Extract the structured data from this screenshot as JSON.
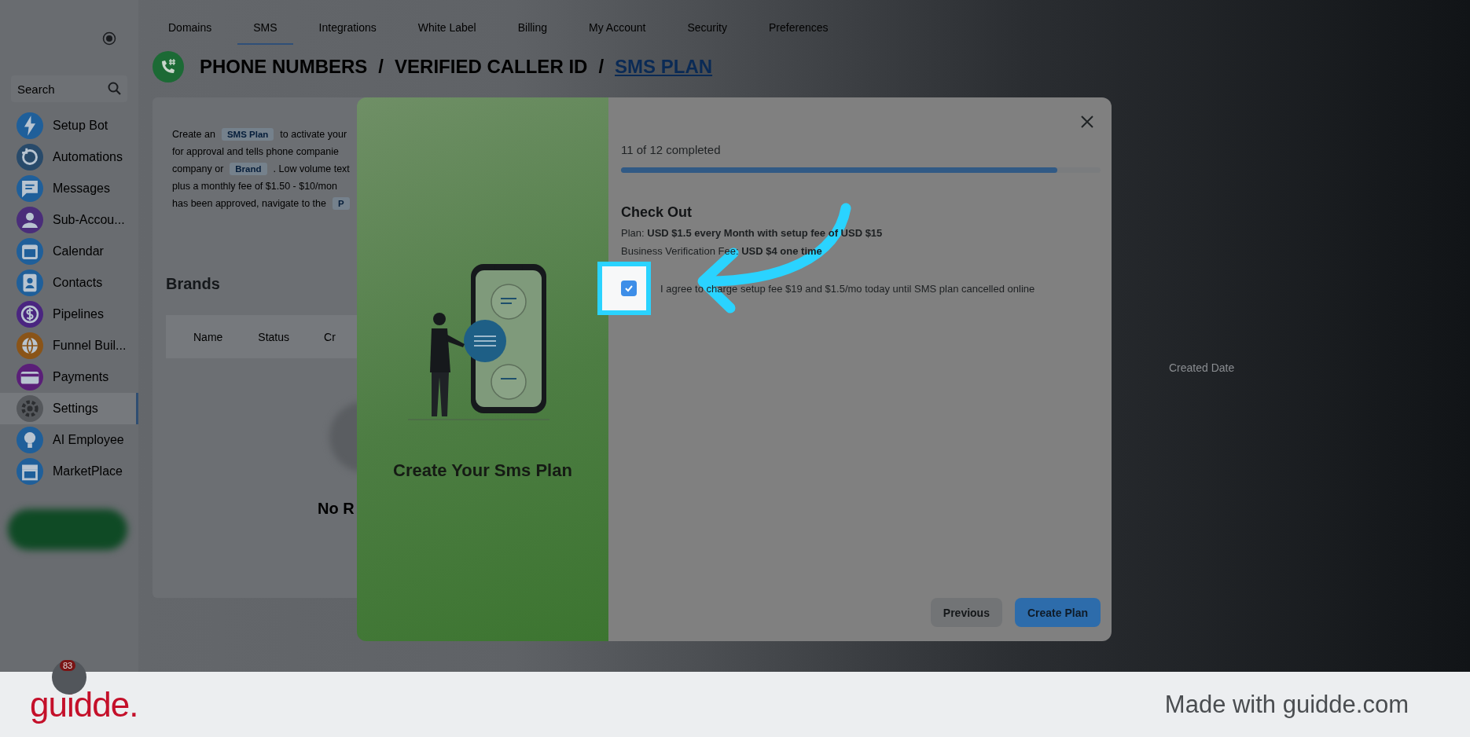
{
  "sidebar": {
    "search": {
      "placeholder": "Search"
    },
    "items": [
      {
        "label": "Setup Bot",
        "color": "#1f5f9a",
        "selected": false
      },
      {
        "label": "Automations",
        "color": "#284a6a",
        "selected": false
      },
      {
        "label": "Messages",
        "color": "#1f5f9a",
        "selected": false
      },
      {
        "label": "Sub-Accou...",
        "color": "#4a2d7a",
        "selected": false
      },
      {
        "label": "Calendar",
        "color": "#1f5f9a",
        "selected": false
      },
      {
        "label": "Contacts",
        "color": "#1f5f9a",
        "selected": false
      },
      {
        "label": "Pipelines",
        "color": "#4a2580",
        "selected": false
      },
      {
        "label": "Funnel Buil...",
        "color": "#8a5418",
        "selected": false
      },
      {
        "label": "Payments",
        "color": "#5a1f78",
        "selected": false
      },
      {
        "label": "Settings",
        "color": "#55585c",
        "selected": true
      },
      {
        "label": "AI Employee",
        "color": "#1f5f9a",
        "selected": false
      },
      {
        "label": "MarketPlace",
        "color": "#1f5f9a",
        "selected": false
      }
    ],
    "notification_badge": "83"
  },
  "top_tabs": [
    {
      "label": "Domains",
      "selected": false
    },
    {
      "label": "SMS",
      "selected": true
    },
    {
      "label": "Integrations",
      "selected": false
    },
    {
      "label": "White Label",
      "selected": false
    },
    {
      "label": "Billing",
      "selected": false
    },
    {
      "label": "My Account",
      "selected": false
    },
    {
      "label": "Security",
      "selected": false
    },
    {
      "label": "Preferences",
      "selected": false
    }
  ],
  "breadcrumb": [
    {
      "kind": "crumb",
      "label": "PHONE NUMBERS",
      "selected": false
    },
    {
      "kind": "separator",
      "label": "/"
    },
    {
      "kind": "crumb",
      "label": "VERIFIED CALLER ID",
      "selected": false
    },
    {
      "kind": "separator",
      "label": "/"
    },
    {
      "kind": "crumb",
      "label": "SMS PLAN",
      "selected": true
    }
  ],
  "intro": {
    "lines": [
      [
        {
          "kind": "text",
          "text": "Create an"
        },
        {
          "kind": "tag",
          "text": "SMS Plan"
        },
        {
          "kind": "text",
          "text": "to activate your"
        }
      ],
      [
        {
          "kind": "text",
          "text": "for approval and tells phone companie"
        }
      ],
      [
        {
          "kind": "text",
          "text": "company or"
        },
        {
          "kind": "tag",
          "text": "Brand"
        },
        {
          "kind": "text",
          "text": ". Low volume text"
        }
      ],
      [
        {
          "kind": "text",
          "text": "plus a monthly fee of $1.50 - $10/mon"
        }
      ],
      [
        {
          "kind": "text",
          "text": "has been approved, navigate to the"
        },
        {
          "kind": "tag",
          "text": "P"
        }
      ]
    ]
  },
  "brands": {
    "title": "Brands",
    "columns": [
      "Name",
      "Status",
      "Cr"
    ],
    "empty_text": "No R",
    "right_column": "Created Date"
  },
  "modal": {
    "side_title": "Create Your Sms Plan",
    "progress": {
      "label": "11 of 12 completed",
      "level": 0.91
    },
    "section_title": "Check Out",
    "details": [
      "Plan:  **USD $1.5 every Month with setup fee of USD $15**",
      "Business Verification Fee:  **USD $4 one time**"
    ],
    "agreement": {
      "text": "I agree to charge setup fee $19 and $1.5/mo today until SMS plan cancelled online",
      "checked": true
    },
    "buttons": [
      {
        "label": "Previous",
        "kind": "secondary"
      },
      {
        "label": "Create Plan",
        "kind": "primary"
      }
    ]
  },
  "footer": {
    "logo": "guidde.",
    "credit": "Made with guidde.com"
  }
}
